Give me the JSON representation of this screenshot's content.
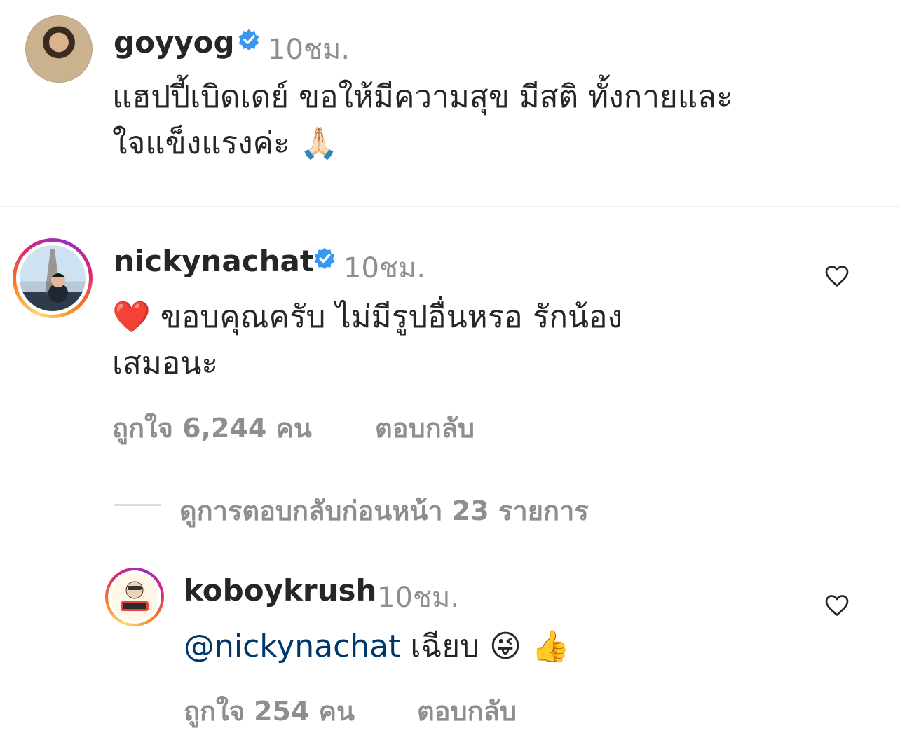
{
  "comments": [
    {
      "username": "goyyog",
      "verified": true,
      "time": "10ชม.",
      "text_line1": "แฮปปี้เบิดเดย์ ขอให้มีความสุข มีสติ ทั้งกายและ",
      "text_line2": "ใจแข็งแรงค่ะ",
      "emoji": "🙏🏻",
      "icon": "avatar-photo"
    },
    {
      "username": "nickynachat",
      "verified": true,
      "time": "10ชม.",
      "emoji": "❤️",
      "text_line1": "ขอบคุณครับ ไม่มีรูปอื่นหรอ รักน้อง",
      "text_line2": "เสมอนะ",
      "likes": "ถูกใจ 6,244 คน",
      "reply_label": "ตอบกลับ",
      "view_replies": "ดูการตอบกลับก่อนหน้า 23 รายการ"
    }
  ],
  "reply": {
    "username": "koboykrush",
    "time": "10ชม.",
    "mention": "@nickynachat",
    "text": "เฉียบ",
    "emoji1": "😜",
    "emoji2": "👍",
    "likes": "ถูกใจ 254 คน",
    "reply_label": "ตอบกลับ"
  },
  "colors": {
    "verified": "#3897f0",
    "muted": "#8e8e8e",
    "mention": "#00376b",
    "text": "#262626"
  }
}
